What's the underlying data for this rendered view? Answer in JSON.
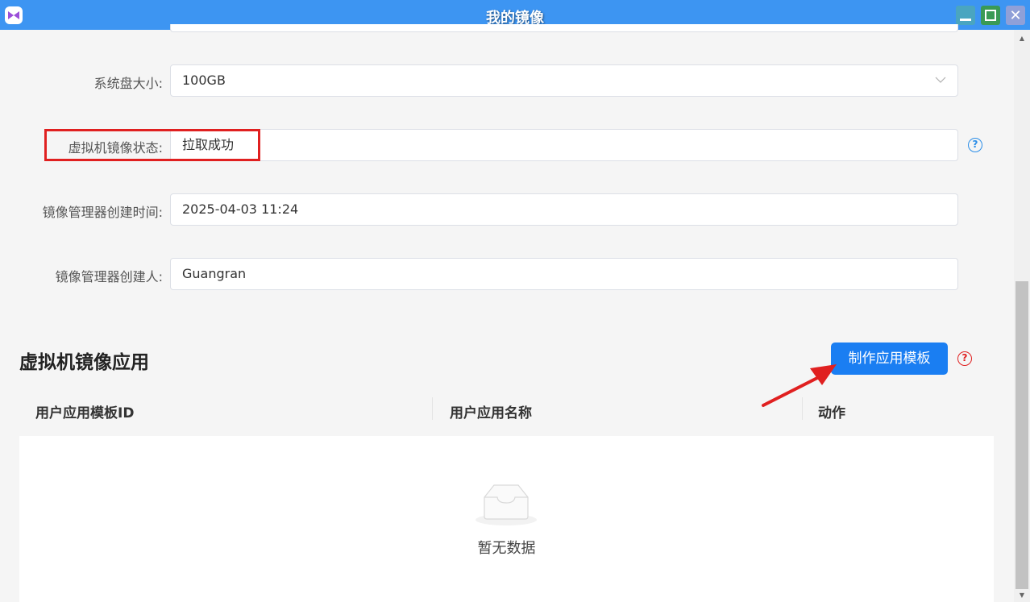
{
  "window": {
    "title": "我的镜像"
  },
  "form": {
    "disk_size": {
      "label": "系统盘大小:",
      "value": "100GB"
    },
    "vm_image_status": {
      "label": "虚拟机镜像状态:",
      "value": "拉取成功"
    },
    "created_time": {
      "label": "镜像管理器创建时间:",
      "value": "2025-04-03 11:24"
    },
    "creator": {
      "label": "镜像管理器创建人:",
      "value": "Guangran"
    }
  },
  "section": {
    "title": "虚拟机镜像应用",
    "make_template_button": "制作应用模板"
  },
  "table": {
    "columns": [
      "用户应用模板ID",
      "用户应用名称",
      "动作"
    ],
    "rows": [],
    "empty_text": "暂无数据"
  },
  "colors": {
    "titlebar": "#3d95f2",
    "primary_button": "#1a7ef2",
    "highlight": "#e02020"
  }
}
